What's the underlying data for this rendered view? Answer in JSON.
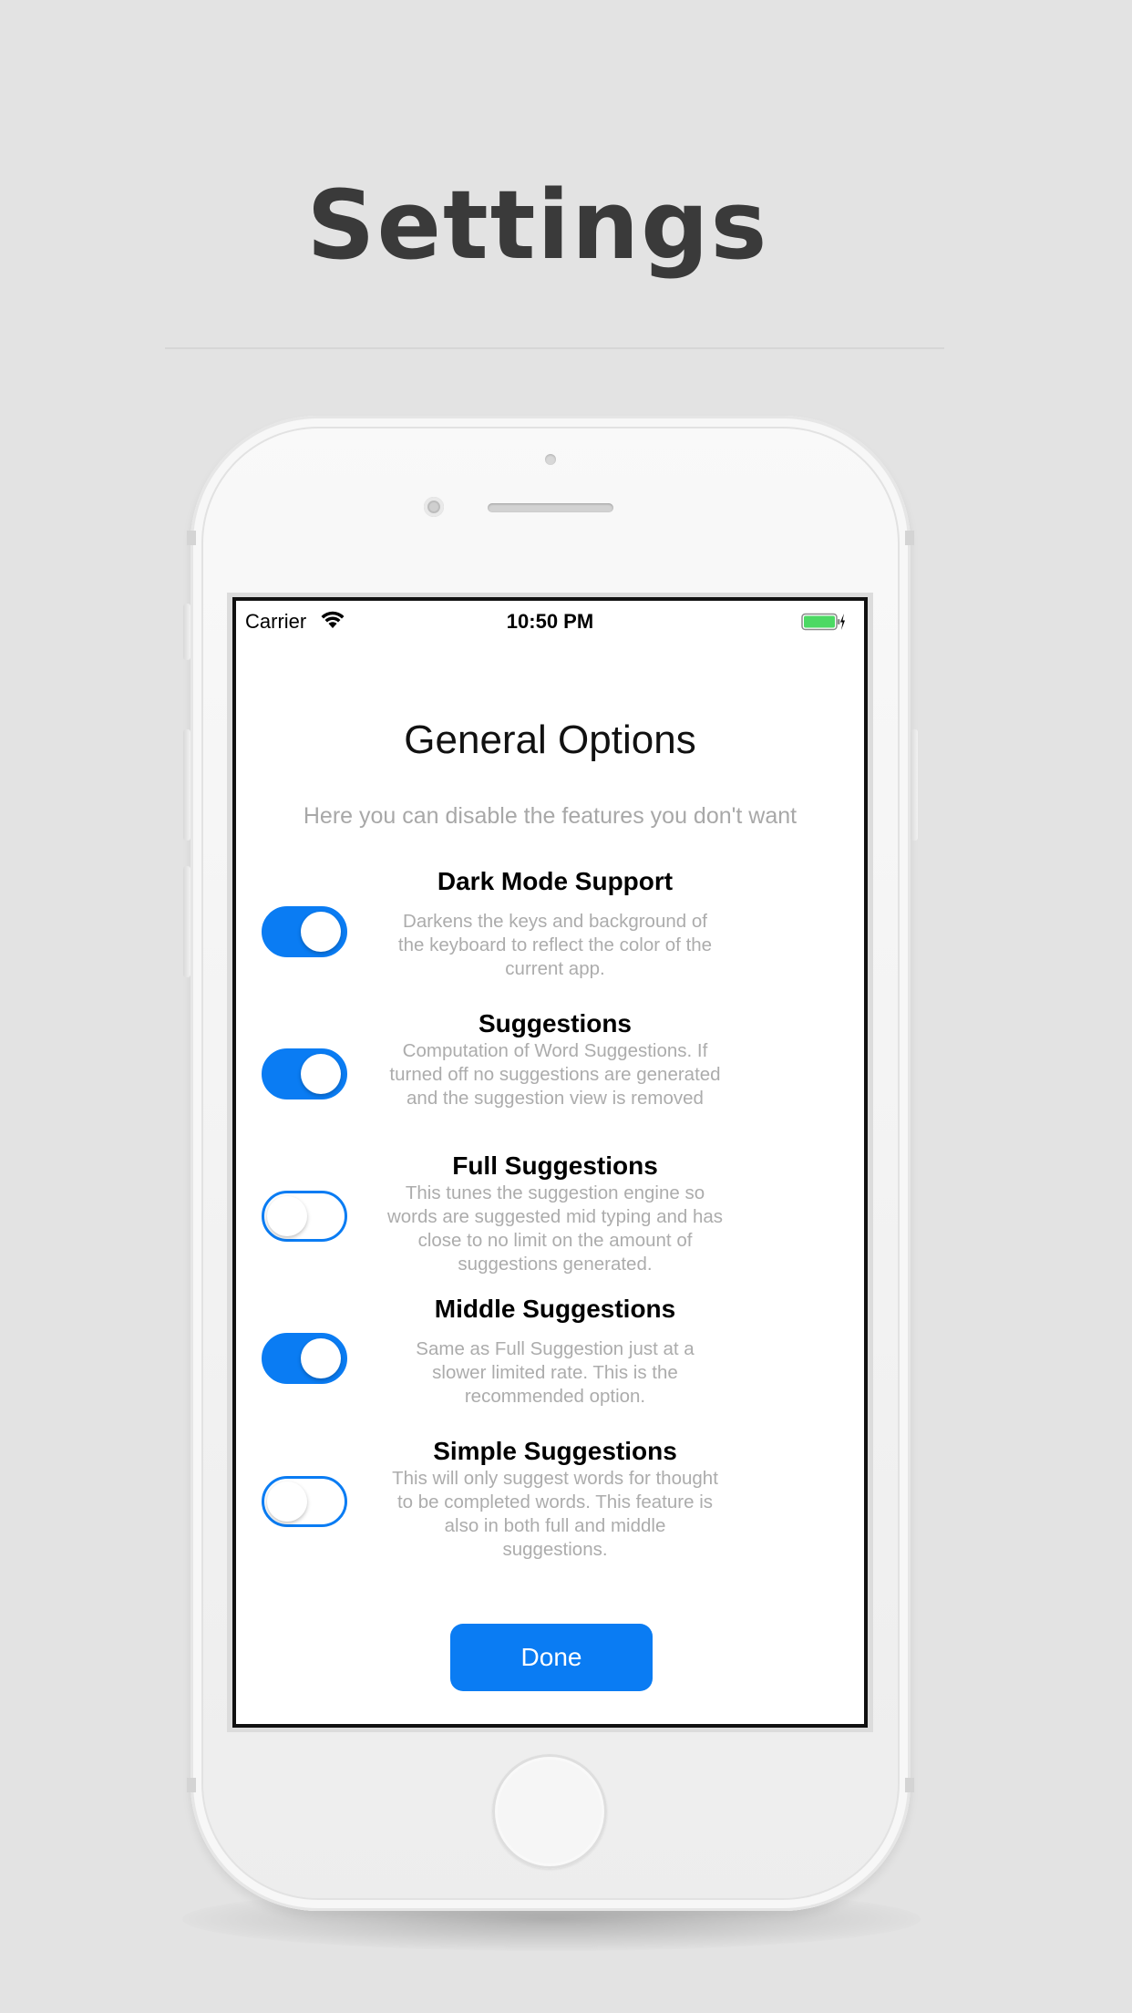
{
  "headline": "Settings",
  "status_bar": {
    "carrier": "Carrier",
    "time": "10:50 PM",
    "battery_color": "#4cd964"
  },
  "screen": {
    "title": "General Options",
    "subtitle": "Here you can disable the features you don't want",
    "options": [
      {
        "title": "Dark Mode Support",
        "description": "Darkens the keys and background of the keyboard to reflect the color of the current app.",
        "enabled": true
      },
      {
        "title": "Suggestions",
        "description": "Computation of Word Suggestions. If turned off no suggestions are generated and the suggestion view is removed",
        "enabled": true
      },
      {
        "title": "Full Suggestions",
        "description": "This tunes the suggestion engine so words are suggested mid typing and has close to no limit on the amount of suggestions generated.",
        "enabled": false
      },
      {
        "title": "Middle Suggestions",
        "description": "Same as Full Suggestion just at a slower limited rate. This is the recommended option.",
        "enabled": true
      },
      {
        "title": "Simple Suggestions",
        "description": "This will only suggest words for thought to be completed words. This feature is also in both full and middle suggestions.",
        "enabled": false
      }
    ],
    "done_label": "Done"
  },
  "colors": {
    "accent": "#0a7cf3",
    "background": "#e3e3e3",
    "headline": "#3a3a3a"
  }
}
